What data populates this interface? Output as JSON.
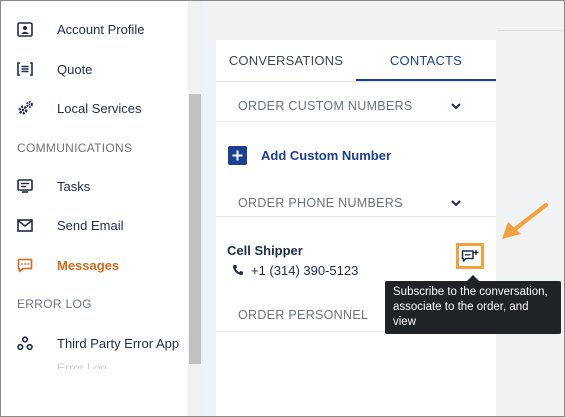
{
  "sidebar": {
    "items": [
      {
        "label": "Account Profile",
        "icon": "account-profile-icon"
      },
      {
        "label": "Quote",
        "icon": "quote-icon"
      },
      {
        "label": "Local Services",
        "icon": "gears-icon"
      },
      {
        "label": "Tasks",
        "icon": "tasks-icon"
      },
      {
        "label": "Send Email",
        "icon": "email-icon"
      },
      {
        "label": "Messages",
        "icon": "messages-icon",
        "active": true
      },
      {
        "label": "Third Party Error App",
        "icon": "error-app-icon"
      }
    ],
    "sections": {
      "communications": "COMMUNICATIONS",
      "error_log": "ERROR LOG"
    },
    "faded_overflow_text": "Error Log"
  },
  "tabs": {
    "conversations": "CONVERSATIONS",
    "contacts": "CONTACTS",
    "active": "contacts"
  },
  "contacts_panel": {
    "order_custom_numbers": "ORDER CUSTOM NUMBERS",
    "add_custom_number": "Add Custom Number",
    "order_phone_numbers": "ORDER PHONE NUMBERS",
    "contact": {
      "name": "Cell Shipper",
      "phone": "+1 (314) 390-5123"
    },
    "order_personnel": "ORDER PERSONNEL"
  },
  "tooltip": {
    "text": "Subscribe to the conversation, associate to the order, and view"
  },
  "colors": {
    "brand_blue": "#1c3f94",
    "active_orange": "#d2691e",
    "highlight_orange": "#f2a13c",
    "tooltip_bg": "#1f2328"
  }
}
